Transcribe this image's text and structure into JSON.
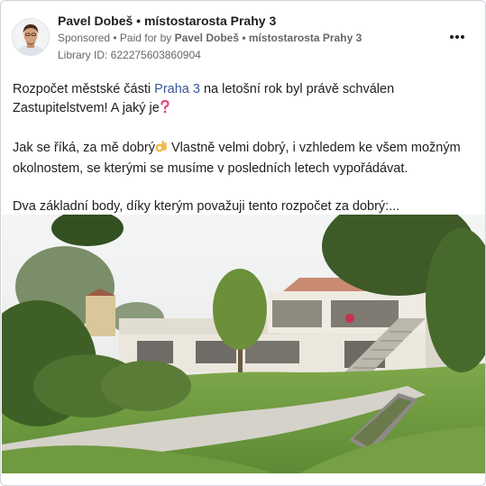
{
  "header": {
    "page_name": "Pavel Dobeš • místostarosta Prahy 3",
    "sponsored_label": "Sponsored",
    "paid_for_by_label": " • Paid for by ",
    "paid_for_by_name": "Pavel Dobeš • místostarosta Prahy 3",
    "library_id_label": "Library ID: 622275603860904",
    "more_icon": "more-horizontal-icon"
  },
  "post": {
    "line1_a": "Rozpočet městské části ",
    "line1_link": "Praha 3",
    "line1_b": " na letošní rok byl právě schválen Zastupitelstvem! A jaký je",
    "line1_emoji": "❓",
    "para2_a": "Jak se říká, za mě dobrý",
    "para2_emoji": "👌",
    "para2_b": " Vlastně velmi dobrý, i vzhledem ke všem možným okolnostem, se kterými se musíme v posledních letech vypořádávat.",
    "para3": "Dva základní body, díky kterým považuji tento rozpočet za dobrý:..."
  },
  "colors": {
    "link": "#385898",
    "meta_text": "#65676b",
    "emoji_question": "#e34b7a"
  }
}
